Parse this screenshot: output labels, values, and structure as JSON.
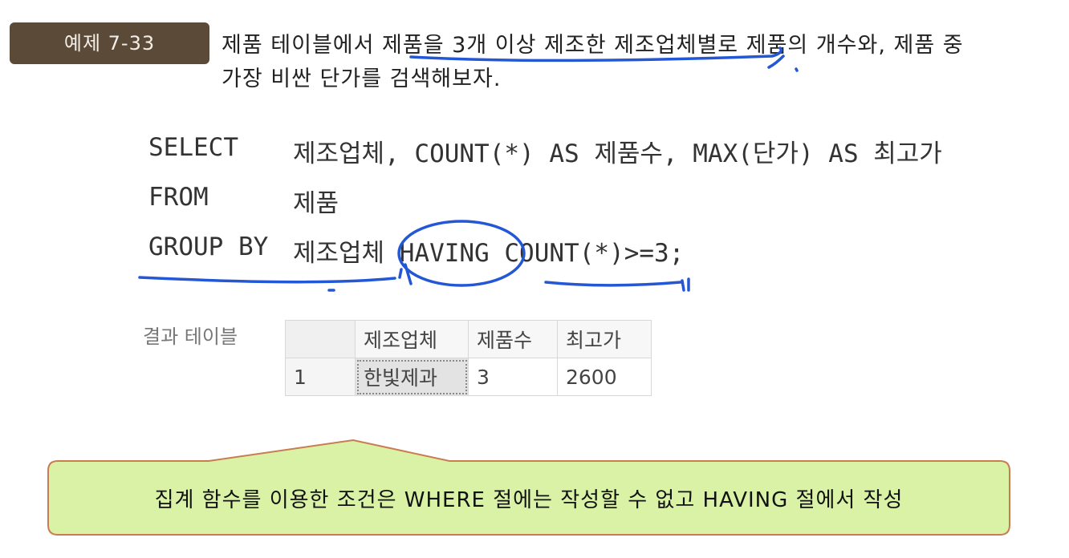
{
  "example": {
    "label": "예제 7-33",
    "question_line1": "제품 테이블에서 제품을 3개 이상 제조한 제조업체별로 제품의 개수와, 제품 중",
    "question_line2": "가장 비싼 단가를 검색해보자."
  },
  "sql": {
    "select_kw": "SELECT",
    "select_body": "제조업체, COUNT(*) AS 제품수, MAX(단가) AS 최고가",
    "from_kw": "FROM",
    "from_body": "제품",
    "group_kw": "GROUP BY",
    "group_body": "제조업체 HAVING COUNT(*)>=3;"
  },
  "result": {
    "label": "결과 테이블",
    "columns": [
      "제조업체",
      "제품수",
      "최고가"
    ],
    "rows": [
      {
        "index": "1",
        "cells": [
          "한빛제과",
          "3",
          "2600"
        ]
      }
    ]
  },
  "note": {
    "text": "집계 함수를 이용한 조건은 WHERE 절에는 작성할 수 없고 HAVING 절에서 작성"
  },
  "colors": {
    "badge": "#5b4a38",
    "note_fill": "#d9f2a6",
    "note_border": "#c97c52",
    "pen": "#2457d6"
  }
}
